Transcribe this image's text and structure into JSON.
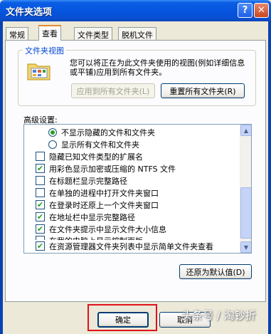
{
  "window": {
    "title": "文件夹选项",
    "help_glyph": "?",
    "close_glyph": "✕"
  },
  "tabs": [
    "常规",
    "查看",
    "文件类型",
    "脱机文件"
  ],
  "folder_views": {
    "group_title": "文件夹视图",
    "description": "您可以将正在为此文件夹使用的视图(例如详细信息或平铺)应用到所有文件夹。",
    "apply_all_label": "应用到所有文件夹(L)",
    "reset_all_label": "重置所有文件夹(R)"
  },
  "advanced": {
    "label": "高级设置:",
    "items": [
      {
        "type": "radio",
        "checked": true,
        "text": "不显示隐藏的文件和文件夹"
      },
      {
        "type": "radio",
        "checked": false,
        "text": "显示所有文件和文件夹"
      },
      {
        "type": "checkbox",
        "checked": false,
        "text": "隐藏已知文件类型的扩展名"
      },
      {
        "type": "checkbox",
        "checked": true,
        "text": "用彩色显示加密或压缩的 NTFS 文件"
      },
      {
        "type": "checkbox",
        "checked": false,
        "text": "在标题栏显示完整路径"
      },
      {
        "type": "checkbox",
        "checked": false,
        "text": "在单独的进程中打开文件夹窗口"
      },
      {
        "type": "checkbox",
        "checked": true,
        "text": "在登录时还原上一个文件夹窗口"
      },
      {
        "type": "checkbox",
        "checked": true,
        "text": "在地址栏中显示完整路径"
      },
      {
        "type": "checkbox",
        "checked": true,
        "text": "在文件夹提示中显示文件大小信息"
      },
      {
        "type": "checkbox",
        "checked": false,
        "text": "在我的电脑上显示控制面板"
      },
      {
        "type": "checkbox",
        "checked": true,
        "text": "在资源管理器文件夹列表中显示简单文件夹查看"
      }
    ],
    "restore_defaults_label": "还原为默认值(D)"
  },
  "footer": {
    "ok_label": "确定",
    "cancel_label": "取消",
    "watermark": "头条号 / 淘钞折"
  },
  "colors": {
    "checkmark": "#21a121",
    "highlight_box": "#e0121b",
    "titlebar": "#0553dd"
  }
}
